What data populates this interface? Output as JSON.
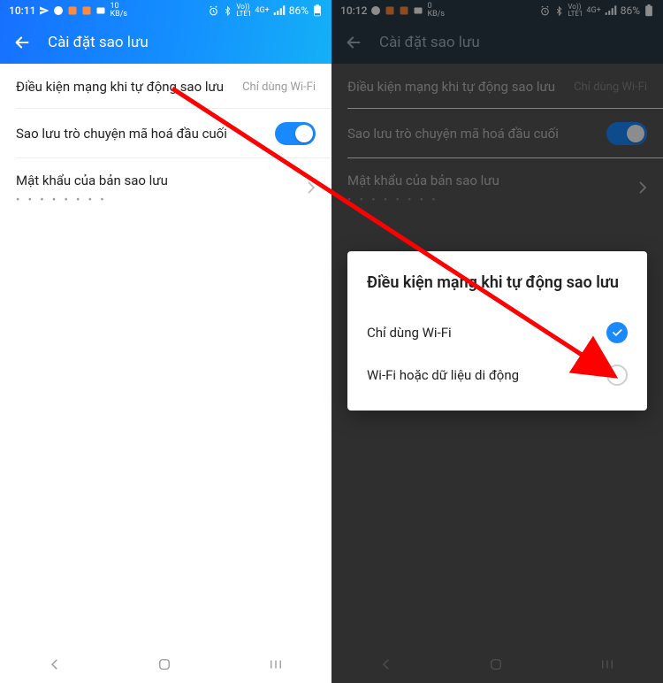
{
  "left": {
    "status": {
      "time": "10:11",
      "kbps_top": "10",
      "kbps_bot": "KB/s",
      "net": "4G+",
      "battery_pct": "86%"
    },
    "header": {
      "title": "Cài đặt sao lưu"
    },
    "rows": {
      "network": {
        "label": "Điều kiện mạng khi tự động sao lưu",
        "value": "Chỉ dùng Wi-Fi"
      },
      "e2e": {
        "label": "Sao lưu trò chuyện mã hoá đầu cuối"
      },
      "pwd": {
        "label": "Mật khẩu của bản sao lưu",
        "sub": "• • • • • • • •"
      }
    }
  },
  "right": {
    "status": {
      "time": "10:12",
      "kbps_top": "0",
      "kbps_bot": "KB/s",
      "net": "4G+",
      "battery_pct": "86%"
    },
    "header": {
      "title": "Cài đặt sao lưu"
    },
    "rows": {
      "network": {
        "label": "Điều kiện mạng khi tự động sao lưu",
        "value": "Chỉ dùng Wi-Fi"
      },
      "e2e": {
        "label": "Sao lưu trò chuyện mã hoá đầu cuối"
      },
      "pwd": {
        "label": "Mật khẩu của bản sao lưu",
        "sub": "• • • • • • • •"
      }
    },
    "dialog": {
      "title": "Điều kiện mạng khi tự động sao lưu",
      "opt1": "Chỉ dùng Wi-Fi",
      "opt2": "Wi-Fi hoặc dữ liệu di động"
    }
  }
}
